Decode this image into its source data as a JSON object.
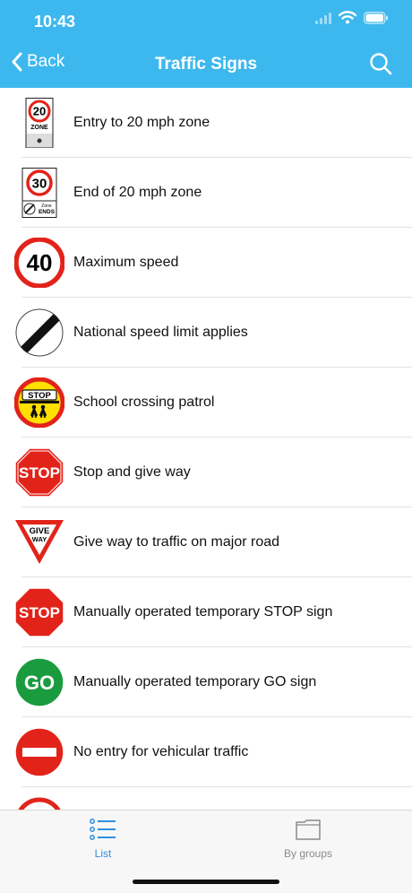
{
  "status": {
    "time": "10:43"
  },
  "nav": {
    "back_label": "Back",
    "title": "Traffic Signs"
  },
  "signs": [
    {
      "label": "Entry to 20 mph zone",
      "icon": "zone-20-entry-icon",
      "number": "20",
      "caption": "ZONE"
    },
    {
      "label": "End of 20 mph zone",
      "icon": "zone-20-end-icon",
      "number": "30",
      "caption": "ENDS",
      "caption_small": "Zone"
    },
    {
      "label": "Maximum speed",
      "icon": "max-speed-40-icon",
      "number": "40"
    },
    {
      "label": "National speed limit applies",
      "icon": "national-speed-limit-icon"
    },
    {
      "label": "School crossing patrol",
      "icon": "school-crossing-patrol-icon",
      "text": "STOP"
    },
    {
      "label": "Stop and give way",
      "icon": "stop-sign-icon",
      "text": "STOP"
    },
    {
      "label": "Give way to traffic on major road",
      "icon": "give-way-icon",
      "text_top": "GIVE",
      "text_bottom": "WAY"
    },
    {
      "label": "Manually operated temporary STOP sign",
      "icon": "temporary-stop-icon",
      "text": "STOP"
    },
    {
      "label": "Manually operated temporary GO sign",
      "icon": "temporary-go-icon",
      "text": "GO"
    },
    {
      "label": "No entry for vehicular traffic",
      "icon": "no-entry-icon"
    }
  ],
  "tabs": {
    "list_label": "List",
    "groups_label": "By groups"
  },
  "colors": {
    "header": "#3db8ee",
    "red": "#e2231a",
    "green": "#1a9b3f",
    "yellow": "#ffe000",
    "active_tab": "#2f8fe0"
  }
}
